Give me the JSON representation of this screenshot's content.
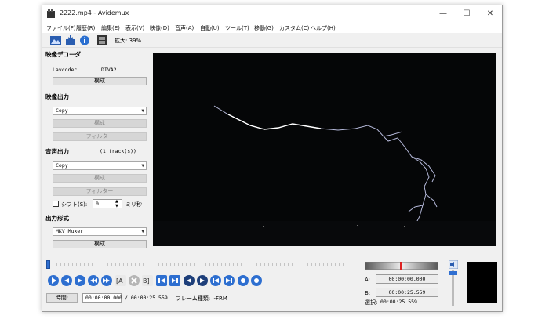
{
  "window": {
    "title": "2222.mp4 - Avidemux"
  },
  "menu": [
    "ファイル(F)",
    "履歴(R)",
    "編集(E)",
    "表示(V)",
    "映像(D)",
    "音声(A)",
    "自動(U)",
    "ツール(T)",
    "移動(G)",
    "カスタム(C)",
    "ヘルプ(H)"
  ],
  "toolbar": {
    "zoom": "拡大: 39%"
  },
  "video_decoder": {
    "title": "映像デコーダ",
    "codec_label": "Lavcodec",
    "codec_value": "DIVA2",
    "configure": "構成"
  },
  "video_output": {
    "title": "映像出力",
    "codec": "Copy",
    "configure": "構成",
    "filters": "フィルター"
  },
  "audio_output": {
    "title": "音声出力",
    "tracks": "(1 track(s))",
    "codec": "Copy",
    "configure": "構成",
    "filters": "フィルター",
    "shift_label": "シフト(S):",
    "shift_value": "0",
    "shift_unit": "ミリ秒"
  },
  "output_format": {
    "title": "出力形式",
    "muxer": "MKV Muxer",
    "configure": "構成"
  },
  "playback": {
    "position": 0.0
  },
  "status": {
    "time_button": "時間:",
    "current_time": "00:00:00.000",
    "total_time": "/ 00:00:25.559",
    "frame_type": "フレーム種類: I-FRM"
  },
  "selection": {
    "a_label": "A:",
    "a_value": "00:00:00.000",
    "b_label": "B:",
    "b_value": "00:00:25.559",
    "sel_label": "選択:",
    "sel_value": "00:00:25.559"
  },
  "colors": {
    "accent": "#2f6fd1",
    "video_bg": "#050607",
    "preview_bg": "#000000"
  }
}
